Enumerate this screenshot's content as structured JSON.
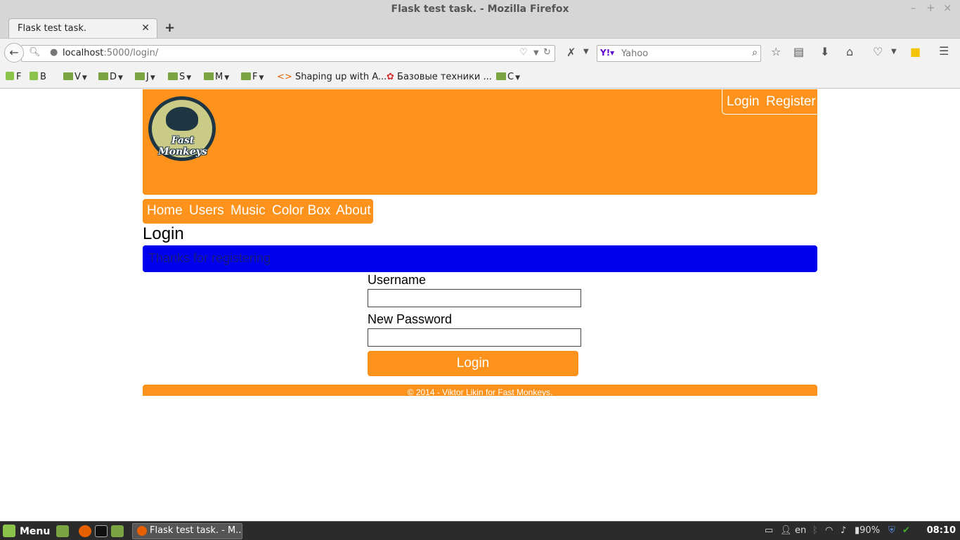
{
  "window": {
    "title": "Flask test task. - Mozilla Firefox"
  },
  "tab": {
    "label": "Flask test task."
  },
  "toolbar": {
    "url_host": "localhost",
    "url_rest": ":5000/login/",
    "search_placeholder": "Yahoo"
  },
  "bookmarks": [
    {
      "label": "F",
      "kind": "mint"
    },
    {
      "label": "B",
      "kind": "mint"
    },
    {
      "label": "V",
      "kind": "folder"
    },
    {
      "label": "D",
      "kind": "folder"
    },
    {
      "label": "J",
      "kind": "folder"
    },
    {
      "label": "S",
      "kind": "folder"
    },
    {
      "label": "M",
      "kind": "folder"
    },
    {
      "label": "F",
      "kind": "folder"
    },
    {
      "label": "Shaping up with A...",
      "kind": "link"
    },
    {
      "label": "Базовые техники ...",
      "kind": "link"
    },
    {
      "label": "C",
      "kind": "folder"
    }
  ],
  "site": {
    "logo_text": "Fast Monkeys",
    "auth": {
      "login": "Login",
      "register": "Register"
    },
    "nav": {
      "home": "Home",
      "users": "Users",
      "music": "Music",
      "color_box": "Color Box",
      "about": "About"
    },
    "page_title": "Login",
    "flash": "Thanks for registering",
    "form": {
      "username_label": "Username",
      "password_label": "New Password",
      "username_value": "",
      "password_value": "",
      "submit": "Login"
    },
    "footer": "© 2014 - Viktor Likin for Fast Monkeys."
  },
  "taskbar": {
    "menu": "Menu",
    "window": "Flask test task. - M...",
    "lang": "en",
    "battery": "90%",
    "clock": "08:10"
  },
  "colors": {
    "accent": "#fd931c",
    "flash_bg": "#0000ee",
    "logo_dark": "#1e3544"
  }
}
